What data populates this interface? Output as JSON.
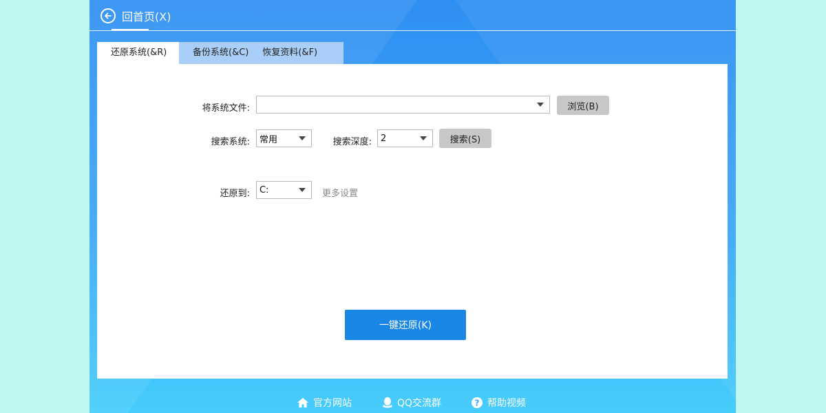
{
  "header": {
    "back_label": "回首页(X)"
  },
  "tabs": [
    {
      "label": "还原系统(&R)",
      "active": true
    },
    {
      "label": "备份系统(&C)",
      "active": false
    },
    {
      "label": "恢复资料(&F)",
      "active": false
    }
  ],
  "form": {
    "file_label": "将系统文件:",
    "file_value": "",
    "browse_label": "浏览(B)",
    "search_system_label": "搜索系统:",
    "search_system_value": "常用",
    "search_depth_label": "搜索深度:",
    "search_depth_value": "2",
    "search_button_label": "搜索(S)",
    "restore_to_label": "还原到:",
    "restore_to_value": "C:",
    "more_settings_label": "更多设置",
    "one_click_restore_label": "一键还原(K)"
  },
  "footer": {
    "official_site": "官方网站",
    "qq_group": "QQ交流群",
    "help_video": "帮助视频"
  },
  "colors": {
    "primary": "#1a86e6",
    "background": "#bdf7f0",
    "window_top": "#2f8ff2",
    "window_bottom": "#46cdfb",
    "tab_inactive": "#a9cef7"
  }
}
